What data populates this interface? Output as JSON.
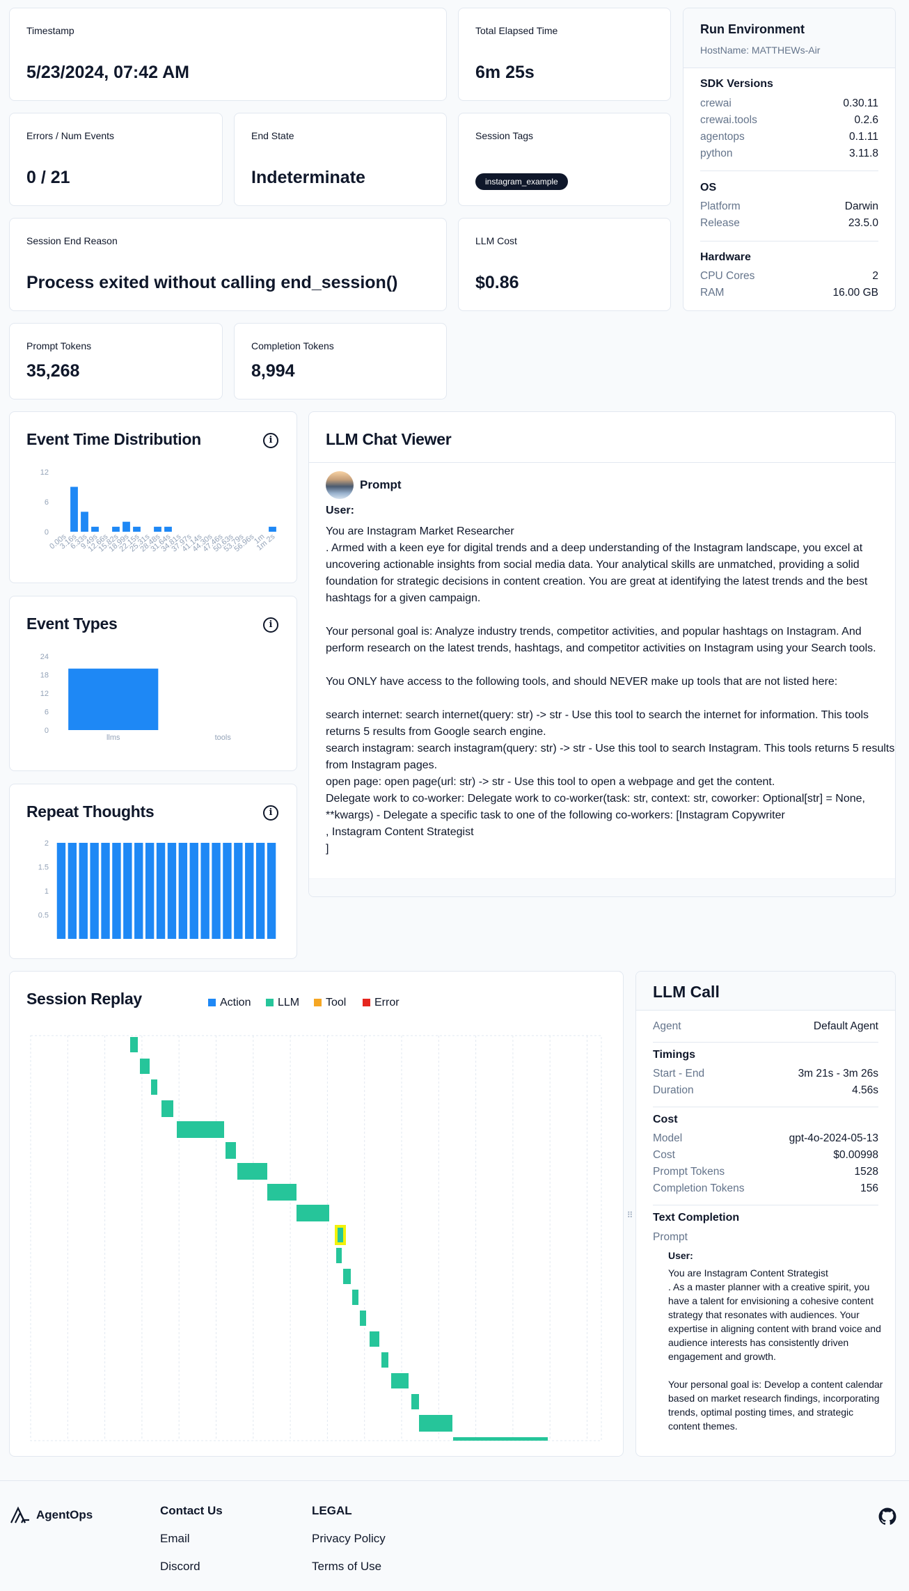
{
  "stats": {
    "timestamp": {
      "label": "Timestamp",
      "value": "5/23/2024, 07:42 AM"
    },
    "elapsed": {
      "label": "Total Elapsed Time",
      "value": "6m 25s"
    },
    "errors": {
      "label": "Errors / Num Events",
      "value": "0 / 21"
    },
    "end_state": {
      "label": "End State",
      "value": "Indeterminate"
    },
    "tags": {
      "label": "Session Tags",
      "items": [
        "instagram_example"
      ]
    },
    "end_reason": {
      "label": "Session End Reason",
      "value": "Process exited without calling end_session()"
    },
    "llm_cost": {
      "label": "LLM Cost",
      "value": "$0.86"
    },
    "prompt_tokens": {
      "label": "Prompt Tokens",
      "value": "35,268"
    },
    "completion_tokens": {
      "label": "Completion Tokens",
      "value": "8,994"
    }
  },
  "env": {
    "title": "Run Environment",
    "host": "HostName: MATTHEWs-Air",
    "sdk_title": "SDK Versions",
    "sdk": [
      {
        "k": "crewai",
        "v": "0.30.11"
      },
      {
        "k": "crewai.tools",
        "v": "0.2.6"
      },
      {
        "k": "agentops",
        "v": "0.1.11"
      },
      {
        "k": "python",
        "v": "3.11.8"
      }
    ],
    "os_title": "OS",
    "os": [
      {
        "k": "Platform",
        "v": "Darwin"
      },
      {
        "k": "Release",
        "v": "23.5.0"
      }
    ],
    "hw_title": "Hardware",
    "hw": [
      {
        "k": "CPU Cores",
        "v": "2"
      },
      {
        "k": "RAM",
        "v": "16.00 GB"
      }
    ]
  },
  "panels": {
    "time_dist": "Event Time Distribution",
    "event_types": "Event Types",
    "repeat": "Repeat Thoughts",
    "info_glyph": "i"
  },
  "chart_data": [
    {
      "type": "bar",
      "title": "Event Time Distribution",
      "categories": [
        "0.00s",
        "3.16s",
        "6.33s",
        "9.49s",
        "12.66s",
        "15.82s",
        "18.99s",
        "22.15s",
        "25.31s",
        "28.48s",
        "31.64s",
        "34.81s",
        "37.97s",
        "41.14s",
        "44.30s",
        "47.46s",
        "50.63s",
        "53.79s",
        "56.96s",
        "1m",
        "1m 2s"
      ],
      "tick_labels": [
        "0.00s",
        "3.16s",
        "6.33s",
        "9.49s",
        "12.66s",
        "15.82s",
        "18.99s",
        "22.15s",
        "25.31s",
        "28.48s",
        "31.64s",
        "34.81s",
        "37.97s",
        "41.14s",
        "44.30s",
        "47.46s",
        "50.63s",
        "53.79s",
        "56.96s",
        "1m",
        "1m 2s"
      ],
      "values": [
        0,
        9,
        4,
        1,
        0,
        1,
        2,
        1,
        0,
        1,
        1,
        0,
        0,
        0,
        0,
        0,
        0,
        0,
        0,
        0,
        1
      ],
      "yticks": [
        0,
        6,
        12
      ],
      "ylim": [
        0,
        12
      ]
    },
    {
      "type": "bar",
      "title": "Event Types",
      "categories": [
        "llms",
        "tools"
      ],
      "values": [
        20,
        0
      ],
      "yticks": [
        0,
        6,
        12,
        18,
        24
      ],
      "ylim": [
        0,
        24
      ]
    },
    {
      "type": "bar",
      "title": "Repeat Thoughts",
      "categories": [
        "1",
        "2",
        "3",
        "4",
        "5",
        "6",
        "7",
        "8",
        "9",
        "10",
        "11",
        "12",
        "13",
        "14",
        "15",
        "16",
        "17",
        "18",
        "19",
        "20"
      ],
      "values": [
        2,
        2,
        2,
        2,
        2,
        2,
        2,
        2,
        2,
        2,
        2,
        2,
        2,
        2,
        2,
        2,
        2,
        2,
        2,
        2
      ],
      "yticks": [
        0.5,
        1,
        1.5,
        2
      ],
      "ylim": [
        0,
        2
      ]
    }
  ],
  "chat": {
    "title": "LLM Chat Viewer",
    "role": "Prompt",
    "speaker": "User:",
    "text": "You are Instagram Market Researcher\n. Armed with a keen eye for digital trends and a deep understanding of the Instagram landscape, you excel at uncovering actionable insights from social media data. Your analytical skills are unmatched, providing a solid foundation for strategic decisions in content creation. You are great at identifying the latest trends and the best hashtags for a given campaign.\n\nYour personal goal is: Analyze industry trends, competitor activities, and popular hashtags on Instagram. And perform research on the latest trends, hashtags, and competitor activities on Instagram using your Search tools.\n\nYou ONLY have access to the following tools, and should NEVER make up tools that are not listed here:\n\nsearch internet: search internet(query: str) -> str - Use this tool to search the internet for information. This tools returns 5 results from Google search engine.\nsearch instagram: search instagram(query: str) -> str - Use this tool to search Instagram. This tools returns 5 results from Instagram pages.\nopen page: open page(url: str) -> str - Use this tool to open a webpage and get the content.\nDelegate work to co-worker: Delegate work to co-worker(task: str, context: str, coworker: Optional[str] = None, **kwargs) - Delegate a specific task to one of the following co-workers: [Instagram Copywriter\n, Instagram Content Strategist\n]"
  },
  "replay": {
    "title": "Session Replay",
    "legend": [
      {
        "label": "Action",
        "color": "#1e88f5"
      },
      {
        "label": "LLM",
        "color": "#26c59a"
      },
      {
        "label": "Tool",
        "color": "#f5a623"
      },
      {
        "label": "Error",
        "color": "#e5261f"
      }
    ],
    "handle_glyph": "⠿"
  },
  "llm_call": {
    "title": "LLM Call",
    "agent_label": "Agent",
    "agent": "Default Agent",
    "timings_title": "Timings",
    "start_end_label": "Start - End",
    "start_end": "3m 21s - 3m 26s",
    "duration_label": "Duration",
    "duration": "4.56s",
    "cost_title": "Cost",
    "model_label": "Model",
    "model": "gpt-4o-2024-05-13",
    "cost_label": "Cost",
    "cost": "$0.00998",
    "prompt_tokens_label": "Prompt Tokens",
    "prompt_tokens": "1528",
    "completion_tokens_label": "Completion Tokens",
    "completion_tokens": "156",
    "completion_title": "Text Completion",
    "prompt_label": "Prompt",
    "speaker": "User:",
    "text": "You are Instagram Content Strategist\n. As a master planner with a creative spirit, you have a talent for envisioning a cohesive content strategy that resonates with audiences. Your expertise in aligning content with brand voice and audience interests has consistently driven engagement and growth.\n\nYour personal goal is: Develop a content calendar based on market research findings, incorporating trends, optimal posting times, and strategic content themes."
  },
  "footer": {
    "brand": "AgentOps",
    "contact_title": "Contact Us",
    "email": "Email",
    "discord": "Discord",
    "legal_title": "LEGAL",
    "privacy": "Privacy Policy",
    "terms": "Terms of Use"
  }
}
